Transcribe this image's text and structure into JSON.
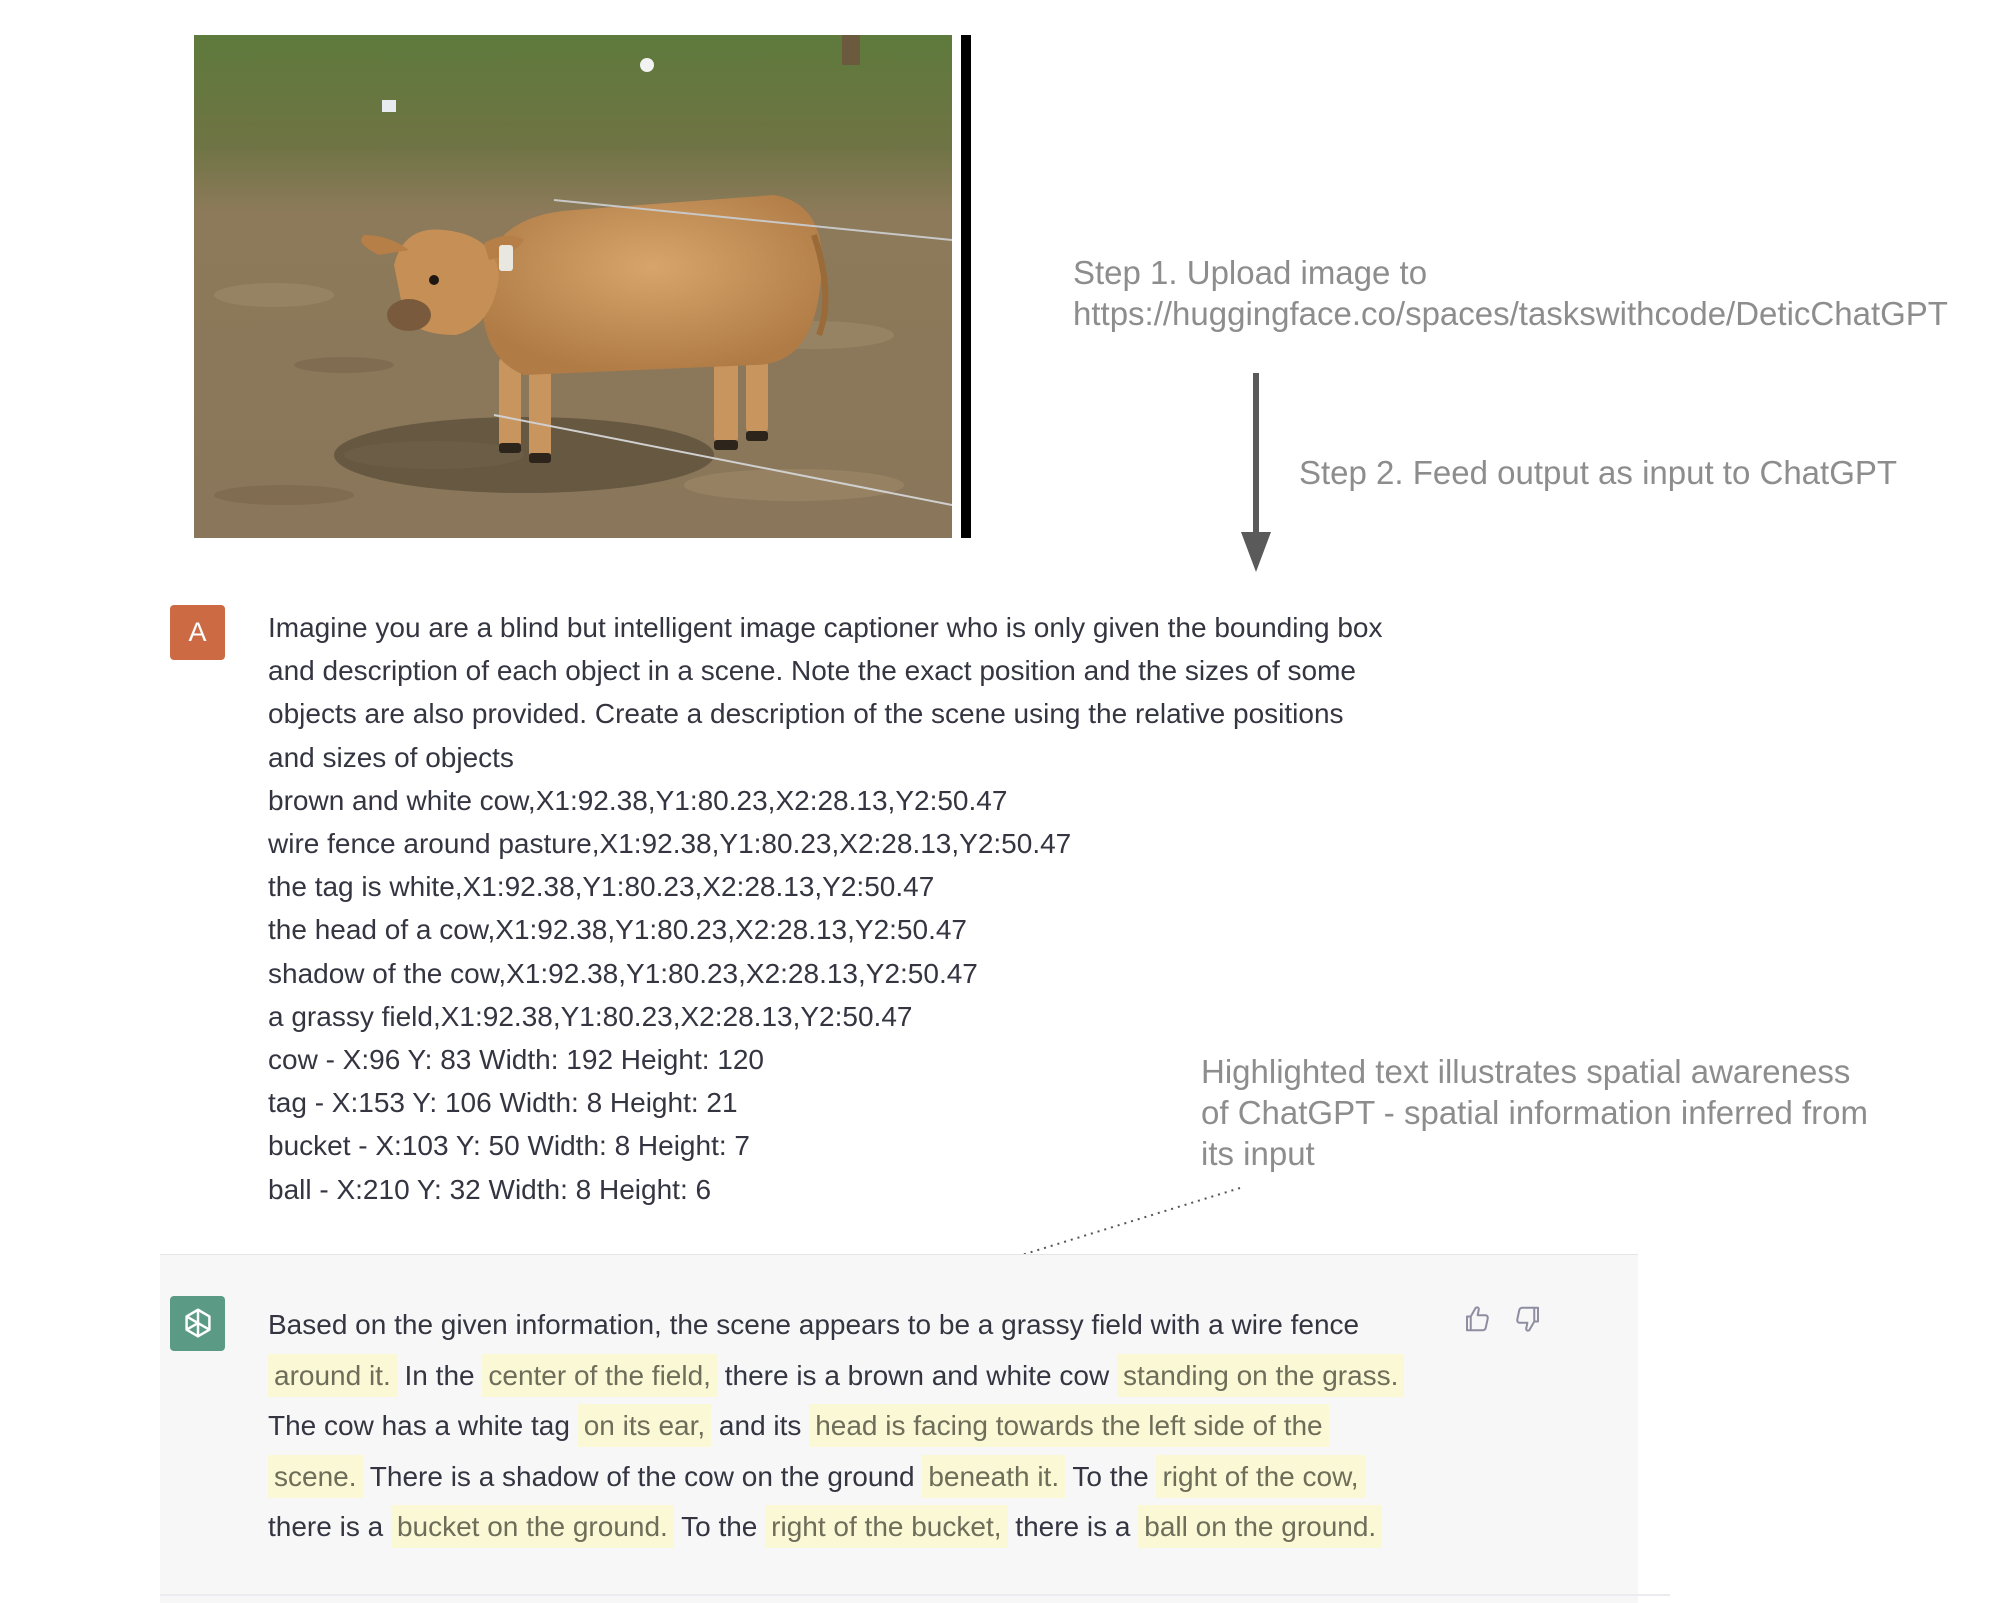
{
  "annotations": {
    "step1_line1": "Step 1. Upload image to",
    "step1_line2": "https://huggingface.co/spaces/taskswithcode/DeticChatGPT",
    "step2": "Step 2. Feed output as input to ChatGPT",
    "highlight_note_lines": [
      "Highlighted text illustrates spatial awareness",
      "of ChatGPT - spatial information inferred from",
      "its input"
    ]
  },
  "user": {
    "avatar_letter": "A",
    "lines": [
      "Imagine you are a blind but intelligent image captioner who is only given the bounding box",
      "and description of each object in a scene. Note the exact position and the sizes of some",
      "objects are also provided. Create a description of the scene using the relative positions",
      "and sizes of objects",
      "brown and white cow,X1:92.38,Y1:80.23,X2:28.13,Y2:50.47",
      "wire fence around pasture,X1:92.38,Y1:80.23,X2:28.13,Y2:50.47",
      "the tag is white,X1:92.38,Y1:80.23,X2:28.13,Y2:50.47",
      "the head of a cow,X1:92.38,Y1:80.23,X2:28.13,Y2:50.47",
      "shadow of the cow,X1:92.38,Y1:80.23,X2:28.13,Y2:50.47",
      "a grassy field,X1:92.38,Y1:80.23,X2:28.13,Y2:50.47",
      "cow - X:96 Y: 83 Width: 192 Height: 120",
      "tag - X:153 Y: 106 Width: 8 Height: 21",
      "bucket - X:103 Y: 50 Width: 8 Height: 7",
      "ball - X:210 Y: 32 Width: 8 Height: 6"
    ]
  },
  "assistant": {
    "avatar_icon": "openai-logo-icon",
    "line1": "Based on the given information, the scene appears to be a grassy field with a wire fence",
    "line2": {
      "h1": "around it.",
      "t1": " In the ",
      "h2": "center of the field,",
      "t2": " there is a brown and white cow ",
      "h3": "standing on the grass."
    },
    "line3": {
      "t1": "The cow has a white tag ",
      "h1": "on its ear,",
      "t2": " and its ",
      "h2": "head is facing towards the left side of the"
    },
    "line4": {
      "h1": "scene.",
      "t1": " There is a shadow of the cow on the ground ",
      "h2": "beneath it.",
      "t2": " To the ",
      "h3": "right of the cow,"
    },
    "line5": {
      "t1": "there is a ",
      "h1": "bucket on the ground.",
      "t2": " To the ",
      "h2": "right of the bucket,",
      "t3": " there is a ",
      "h3": "ball on the ground."
    },
    "feedback_icons": [
      "thumbs-up-icon",
      "thumbs-down-icon"
    ]
  },
  "colors": {
    "user_avatar": "#cc6a43",
    "gpt_avatar": "#5b9a85",
    "highlight": "#fbf8d5",
    "annotation_text": "#8d8d8d",
    "message_text": "#343541"
  }
}
